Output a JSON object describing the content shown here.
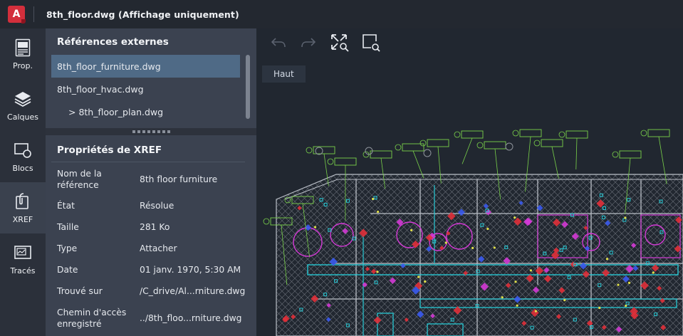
{
  "app": {
    "logo_letter": "A",
    "title": "8th_floor.dwg (Affichage uniquement)",
    "brand_color": "#d32f3c"
  },
  "rail": {
    "items": [
      {
        "label": "Prop.",
        "icon": "properties-icon"
      },
      {
        "label": "Calques",
        "icon": "layers-icon"
      },
      {
        "label": "Blocs",
        "icon": "blocks-icon"
      },
      {
        "label": "XREF",
        "icon": "xref-icon"
      },
      {
        "label": "Tracés",
        "icon": "layouts-icon"
      }
    ],
    "active": "XREF"
  },
  "xref_panel": {
    "title": "Références externes",
    "items": [
      {
        "name": "8th_floor_furniture.dwg",
        "selected": true
      },
      {
        "name": "8th_floor_hvac.dwg",
        "selected": false
      },
      {
        "name": "> 8th_floor_plan.dwg",
        "selected": false
      }
    ]
  },
  "properties": {
    "title": "Propriétés de XREF",
    "rows": [
      {
        "key": "Nom de la référence",
        "value": "8th floor furniture"
      },
      {
        "key": "État",
        "value": "Résolue"
      },
      {
        "key": "Taille",
        "value": "281 Ko"
      },
      {
        "key": "Type",
        "value": "Attacher"
      },
      {
        "key": "Date",
        "value": "01 janv. 1970, 5:30 AM"
      },
      {
        "key": "Trouvé sur",
        "value": "/C_drive/Al...rniture.dwg"
      },
      {
        "key": "Chemin d'accès enregistré",
        "value": "../8th_floo...rniture.dwg"
      }
    ]
  },
  "viewer": {
    "toolbar": [
      "undo-icon",
      "redo-icon",
      "zoom-extents-icon",
      "zoom-window-icon"
    ],
    "view_label": "Haut",
    "colors": {
      "background": "#212730",
      "wall": "#b9bec6",
      "magenta": "#d43ad6",
      "red": "#e0303a",
      "cyan": "#27c8d4",
      "green": "#7ad24a",
      "blue": "#3b5bf0",
      "yellow": "#e0e04a"
    }
  }
}
